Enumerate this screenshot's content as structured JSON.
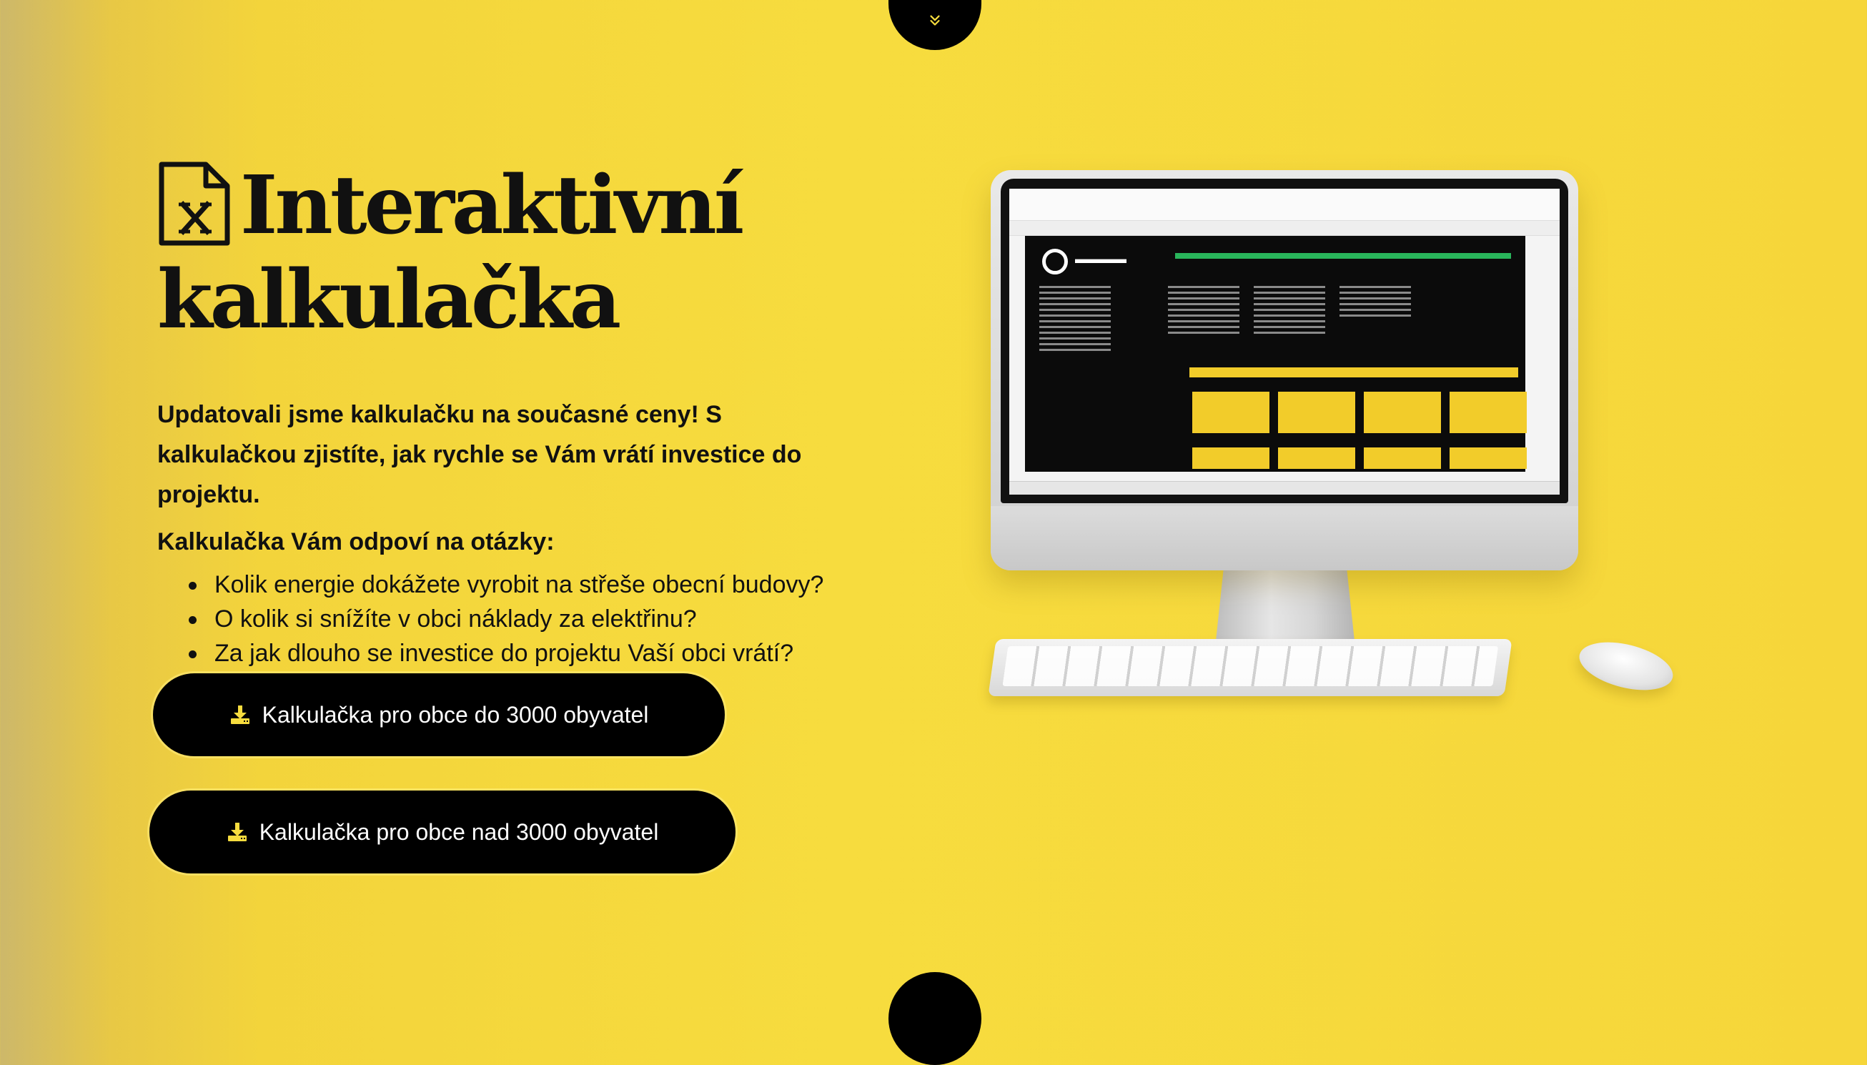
{
  "hero": {
    "title_line1": "Interaktivní",
    "title_line2": "kalkulačka",
    "lead": "Updatovali jsme kalkulačku na současné ceny! S kalkulačkou zjistíte, jak rychle se Vám vrátí investice do projektu.",
    "questions_heading": "Kalkulačka Vám odpoví na otázky:",
    "questions": [
      "Kolik energie dokážete vyrobit na střeše obecní budovy?",
      "O kolik si snížíte v obci náklady za elektřinu?",
      "Za jak dlouho se investice do projektu Vaší obci vrátí?"
    ]
  },
  "buttons": {
    "small_towns_label": "Kalkulačka pro obce do 3000 obyvatel",
    "large_towns_label": "Kalkulačka pro obce nad 3000 obyvatel"
  },
  "icons": {
    "title_icon": "excel-file-icon",
    "button_icon": "download-icon",
    "scroll_icon": "double-chevron-down-icon"
  },
  "colors": {
    "accent_yellow": "#f7dc3e",
    "button_bg": "#000000",
    "text": "#111111"
  }
}
